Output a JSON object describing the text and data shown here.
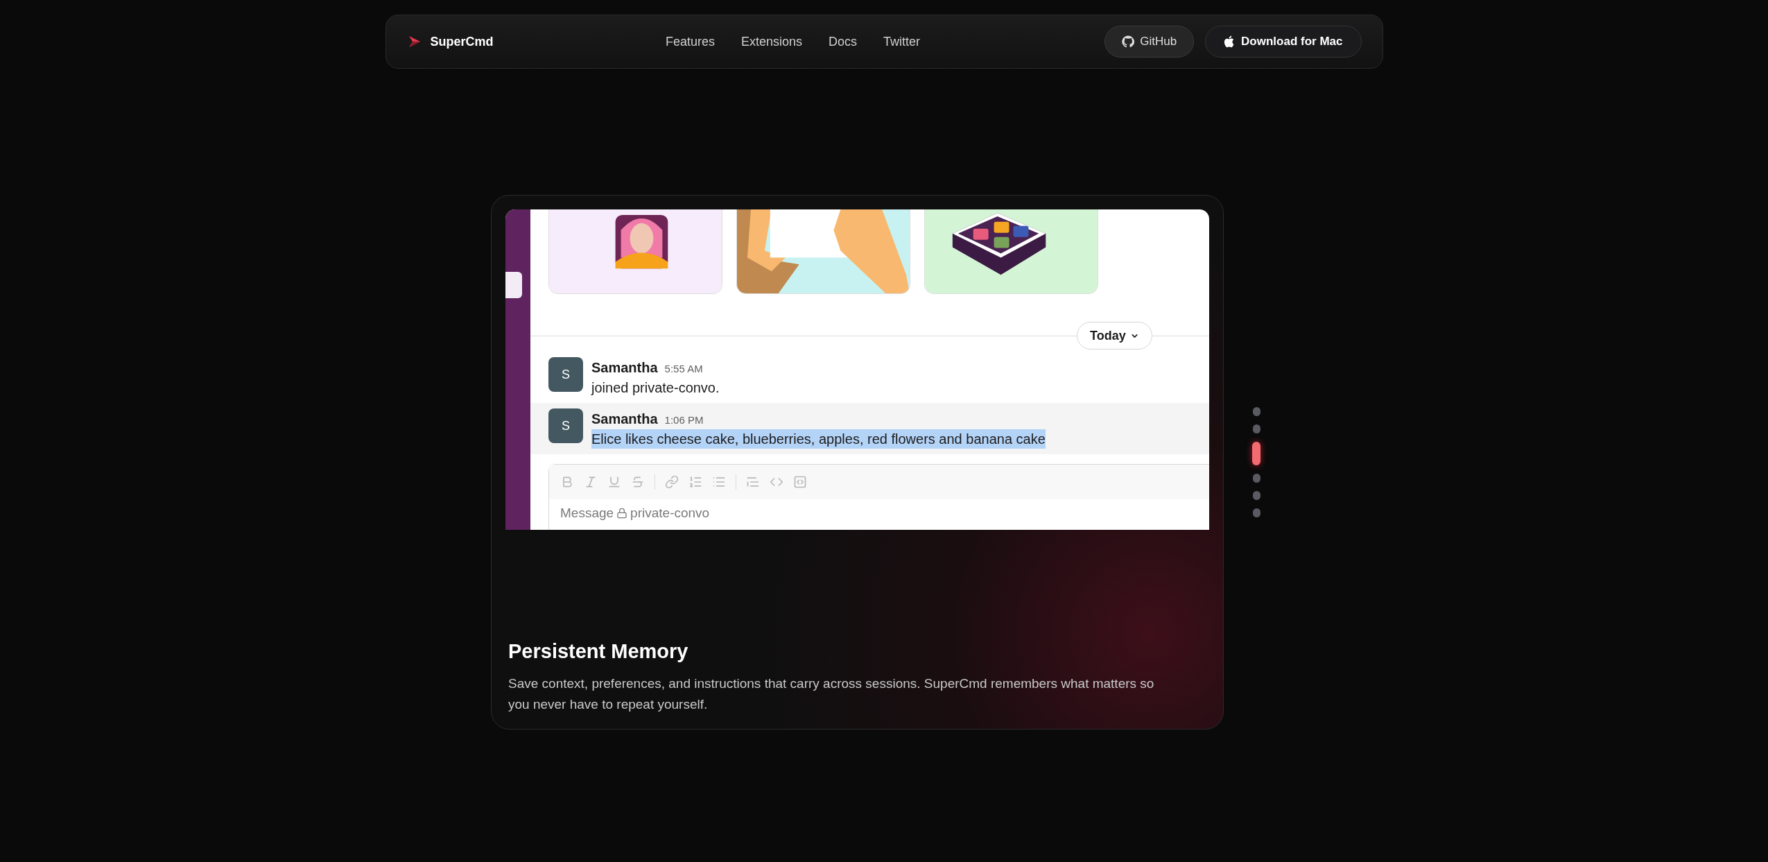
{
  "nav": {
    "brand": "SuperCmd",
    "links": [
      "Features",
      "Extensions",
      "Docs",
      "Twitter"
    ],
    "github": "GitHub",
    "download": "Download for Mac"
  },
  "demo": {
    "today": "Today",
    "messages": [
      {
        "avatar": "S",
        "author": "Samantha",
        "time": "5:55 AM",
        "text": "joined private-convo.",
        "selected": false
      },
      {
        "avatar": "S",
        "author": "Samantha",
        "time": "1:06 PM",
        "text": "Elice likes cheese cake, blueberries, apples, red flowers and banana cake",
        "selected": true
      }
    ],
    "composer": {
      "hint": "Message",
      "channel": "private-convo"
    }
  },
  "feature": {
    "title": "Persistent Memory",
    "description": "Save context, preferences, and instructions that carry across sessions. SuperCmd remembers what matters so you never have to repeat yourself."
  },
  "dots": [
    {
      "selected": false
    },
    {
      "selected": false
    },
    {
      "selected": true
    },
    {
      "selected": false
    },
    {
      "selected": false
    },
    {
      "selected": false
    }
  ]
}
